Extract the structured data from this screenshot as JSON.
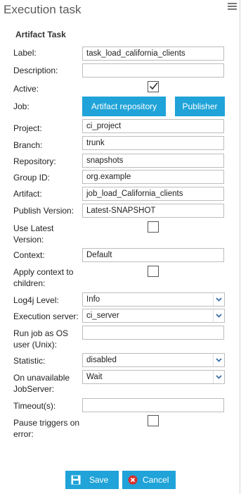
{
  "header": {
    "title": "Execution task",
    "menu_icon": "hamburger-menu-icon"
  },
  "section_title": "Artifact Task",
  "fields": {
    "label": {
      "label": "Label:",
      "value": "task_load_california_clients"
    },
    "description": {
      "label": "Description:",
      "value": ""
    },
    "active": {
      "label": "Active:",
      "checked": true
    },
    "job": {
      "label": "Job:",
      "artifact_button": "Artifact repository",
      "publisher_button": "Publisher"
    },
    "project": {
      "label": "Project:",
      "value": "ci_project"
    },
    "branch": {
      "label": "Branch:",
      "value": "trunk"
    },
    "repository": {
      "label": "Repository:",
      "value": "snapshots"
    },
    "group_id": {
      "label": "Group ID:",
      "value": "org.example"
    },
    "artifact": {
      "label": "Artifact:",
      "value": "job_load_California_clients"
    },
    "publish_version": {
      "label": "Publish Version:",
      "value": "Latest-SNAPSHOT"
    },
    "use_latest": {
      "label_line1": "Use Latest",
      "label_line2": "Version:",
      "checked": false
    },
    "context": {
      "label": "Context:",
      "value": "Default"
    },
    "apply_context": {
      "label_line1": "Apply context to",
      "label_line2": "children:",
      "checked": false
    },
    "log4j": {
      "label": "Log4j Level:",
      "value": "Info"
    },
    "execution_server": {
      "label": "Execution server:",
      "value": "ci_server"
    },
    "run_as_os": {
      "label_line1": "Run job as OS",
      "label_line2": "user (Unix):",
      "value": ""
    },
    "statistic": {
      "label": "Statistic:",
      "value": "disabled"
    },
    "on_unavailable": {
      "label_line1": "On unavailable",
      "label_line2": "JobServer:",
      "value": "Wait"
    },
    "timeout": {
      "label": "Timeout(s):",
      "value": ""
    },
    "pause_triggers": {
      "label_line1": "Pause triggers on",
      "label_line2": "error:",
      "checked": false
    }
  },
  "footer": {
    "save_label": "Save",
    "cancel_label": "Cancel"
  },
  "colors": {
    "accent": "#1fa3d8",
    "cancel_icon": "#d9302c"
  }
}
